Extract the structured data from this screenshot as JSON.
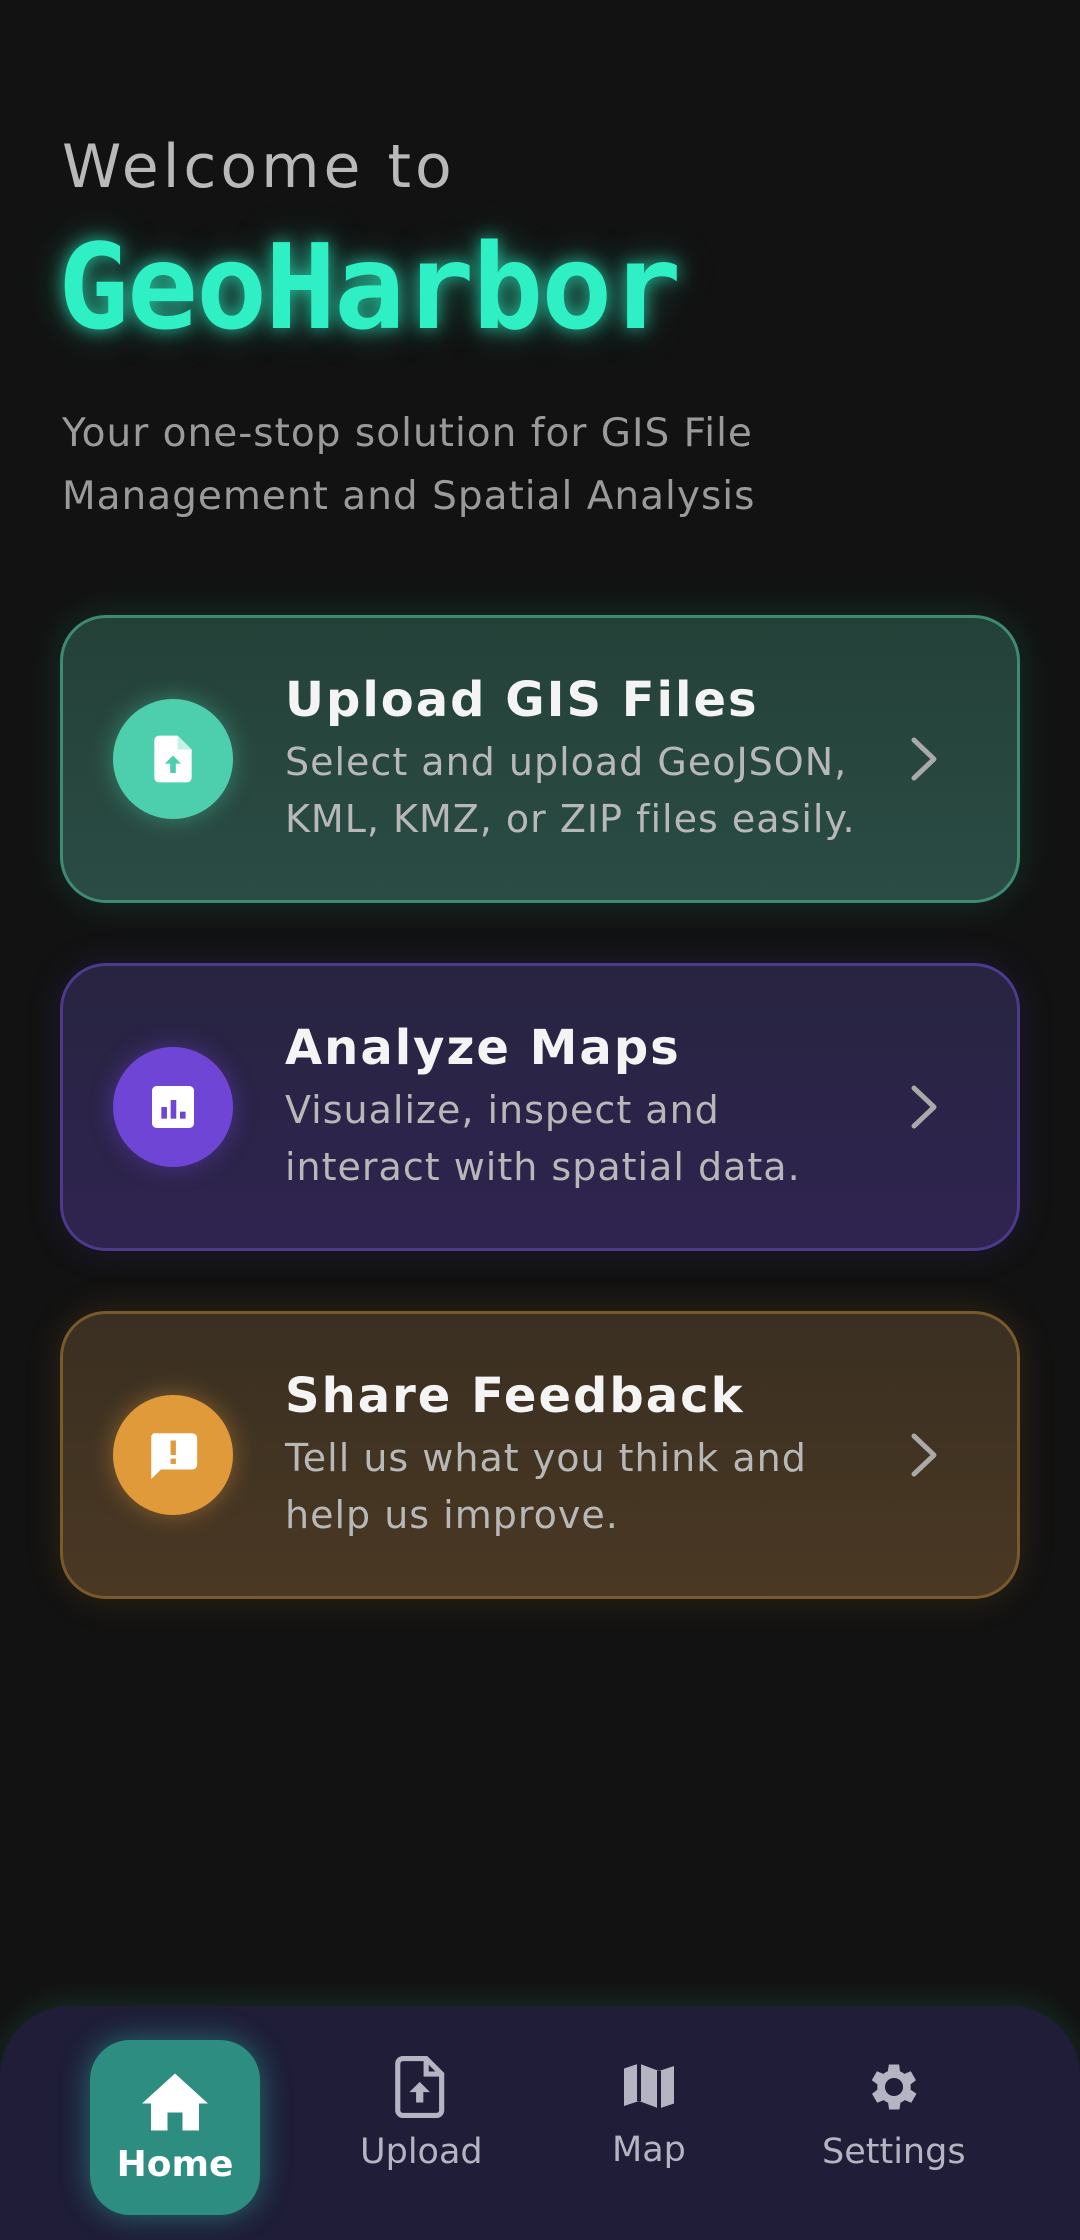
{
  "header": {
    "welcome": "Welcome to",
    "brand": "GeoHarbor",
    "subtitle": "Your one-stop solution for GIS File Management and Spatial Analysis"
  },
  "cards": [
    {
      "title": "Upload GIS Files",
      "description": "Select and upload GeoJSON, KML, KMZ, or ZIP files easily.",
      "icon": "file-upload-icon",
      "accent": "#4dcfae"
    },
    {
      "title": "Analyze Maps",
      "description": "Visualize, inspect and interact with spatial data.",
      "icon": "analytics-icon",
      "accent": "#6f45d6"
    },
    {
      "title": "Share Feedback",
      "description": "Tell us what you think and help us improve.",
      "icon": "feedback-icon",
      "accent": "#e09a3a"
    }
  ],
  "nav": {
    "items": [
      {
        "label": "Home",
        "icon": "home-icon",
        "active": true
      },
      {
        "label": "Upload",
        "icon": "file-upload-icon"
      },
      {
        "label": "Map",
        "icon": "map-icon"
      },
      {
        "label": "Settings",
        "icon": "gear-icon"
      }
    ]
  },
  "colors": {
    "background": "#121212",
    "brand": "#2ff0c4",
    "nav_background": "#1f1d38",
    "nav_active": "#2c8d80"
  }
}
